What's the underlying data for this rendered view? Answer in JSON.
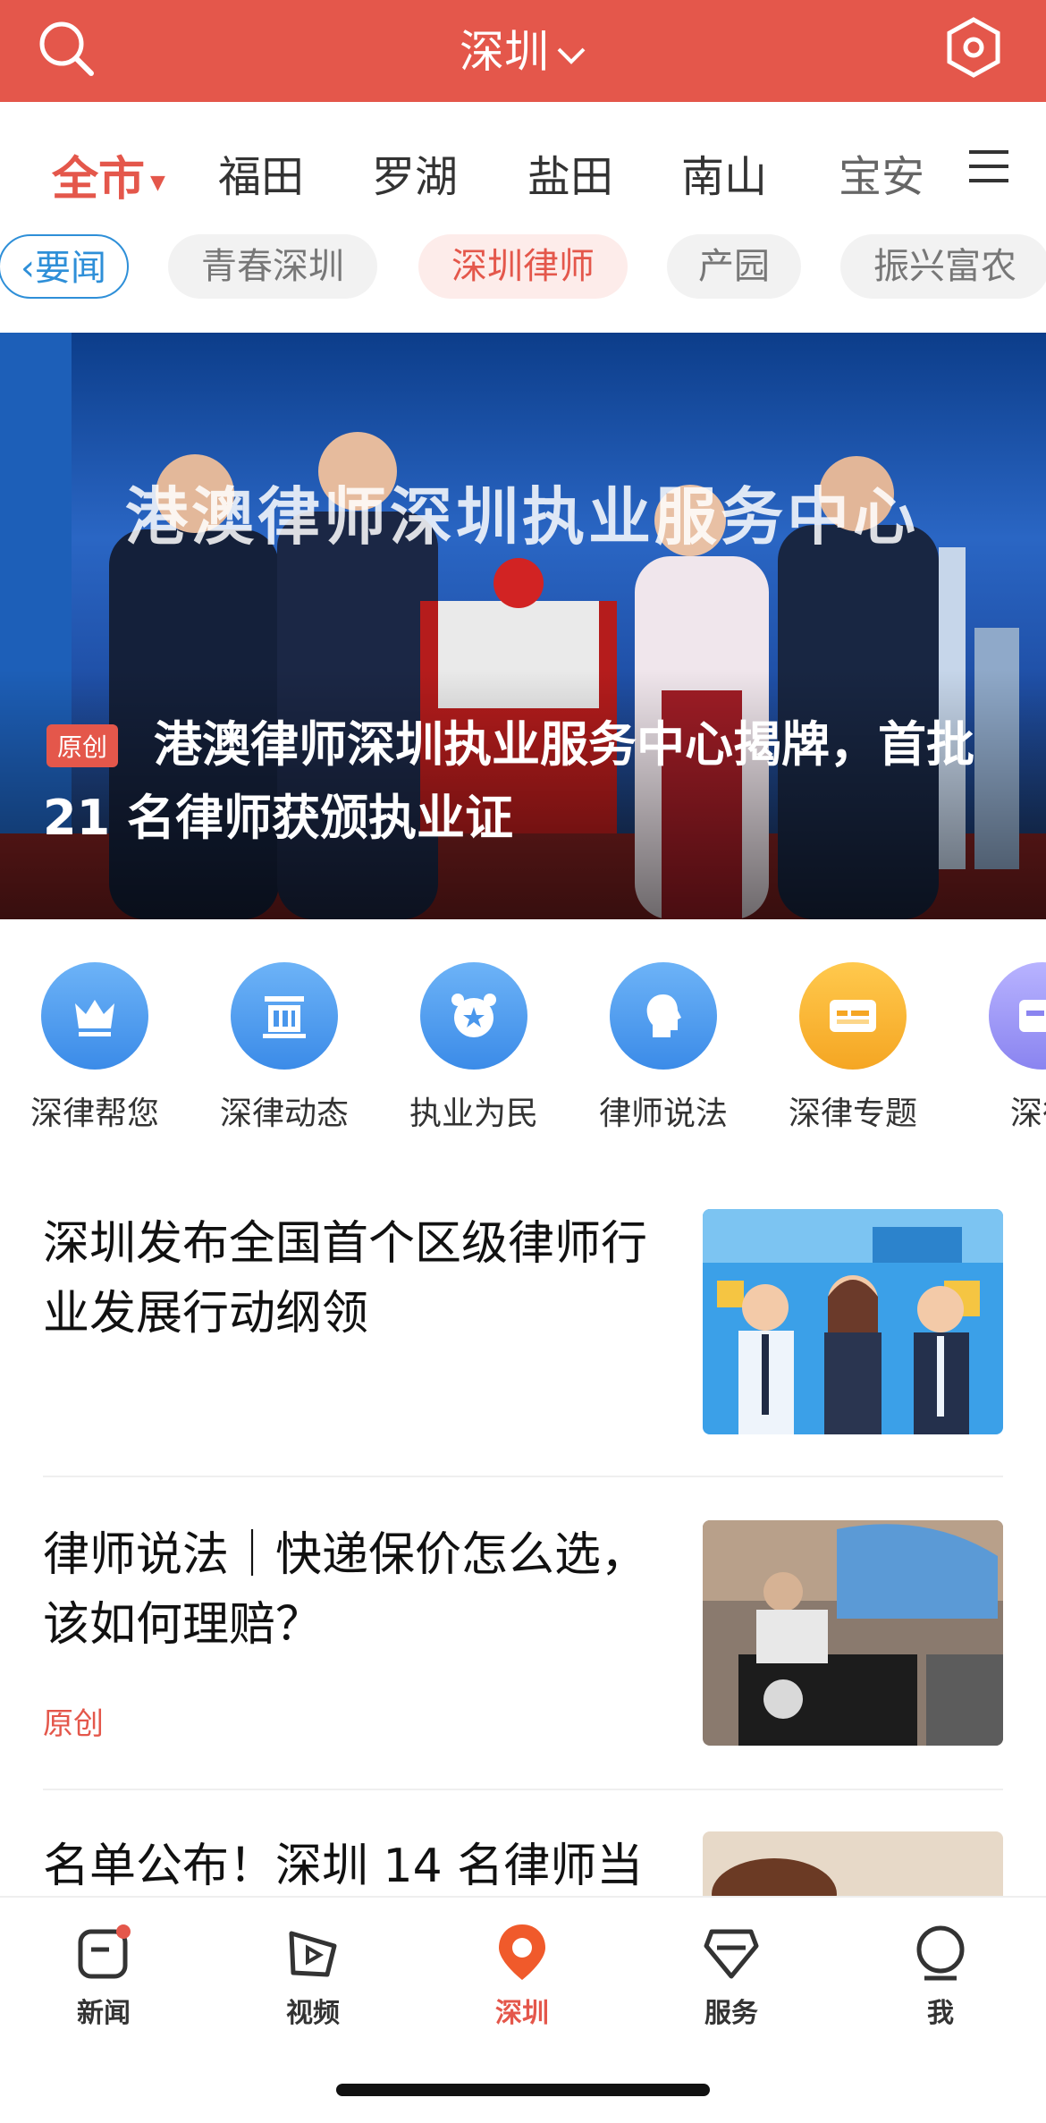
{
  "header": {
    "city": "深圳",
    "bg_color": "#e4574b",
    "left_icon": "search-icon",
    "right_icon": "hexagon-settings-icon"
  },
  "districts": [
    {
      "label": "全市",
      "active": true
    },
    {
      "label": "福田"
    },
    {
      "label": "罗湖"
    },
    {
      "label": "盐田"
    },
    {
      "label": "南山"
    },
    {
      "label": "宝安"
    }
  ],
  "channels": [
    {
      "label": "要闻",
      "style": "back"
    },
    {
      "label": "青春深圳"
    },
    {
      "label": "深圳律师",
      "style": "active"
    },
    {
      "label": "产园"
    },
    {
      "label": "振兴富农"
    }
  ],
  "hero": {
    "banner_text": "港澳律师深圳执业服务中心",
    "tag": "原创",
    "headline": "港澳律师深圳执业服务中心揭牌，首批 21 名律师获颁执业证"
  },
  "shortcuts": [
    {
      "label": "深律帮您",
      "icon": "crown-icon"
    },
    {
      "label": "深律动态",
      "icon": "building-icon"
    },
    {
      "label": "执业为民",
      "icon": "alarm-star-icon"
    },
    {
      "label": "律师说法",
      "icon": "head-icon"
    },
    {
      "label": "深律专题",
      "icon": "card-icon"
    },
    {
      "label": "深律"
    }
  ],
  "articles": [
    {
      "title": "深圳发布全国首个区级律师行业发展行动纲领",
      "meta": ""
    },
    {
      "title": "律师说法｜快递保价怎么选，该如何理赔？",
      "meta": "原创"
    },
    {
      "title": "名单公布！深圳 14 名律师当",
      "meta": ""
    }
  ],
  "bottom_nav": [
    {
      "label": "新闻",
      "icon": "news-icon"
    },
    {
      "label": "视频",
      "icon": "video-icon"
    },
    {
      "label": "深圳",
      "icon": "location-pin-icon",
      "active": true
    },
    {
      "label": "服务",
      "icon": "service-icon"
    },
    {
      "label": "我",
      "icon": "profile-icon"
    }
  ]
}
